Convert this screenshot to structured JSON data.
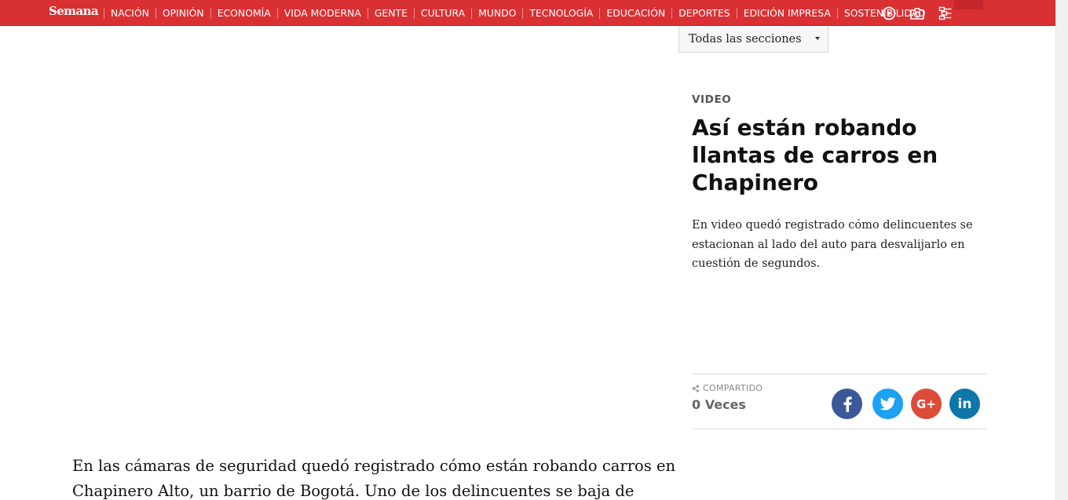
{
  "header": {
    "logo": "Semana",
    "nav_items": [
      "NACIÓN",
      "OPINIÓN",
      "ECONOMÍA",
      "VIDA MODERNA",
      "GENTE",
      "CULTURA",
      "MUNDO",
      "TECNOLOGÍA",
      "EDUCACIÓN",
      "DEPORTES",
      "EDICIÓN IMPRESA",
      "SOSTENIBILIDAD"
    ],
    "icons": [
      "play-icon",
      "camera-icon",
      "sections-menu-icon"
    ],
    "bar_color": "#d93034"
  },
  "section_select": {
    "value": "Todas las secciones"
  },
  "article": {
    "category": "VIDEO",
    "title": "Así están robando llantas de carros en Chapinero",
    "lead": "En video quedó registrado cómo delincuentes se estacionan al lado del auto para desvalijarlo en cuestión de segundos.",
    "body": "En las cámaras de seguridad quedó registrado cómo están robando carros en Chapinero Alto, un barrio de Bogotá. Uno de los delincuentes se baja de"
  },
  "share": {
    "label": "COMPARTIDO",
    "count": "0 Veces",
    "networks": [
      {
        "name": "facebook",
        "glyph": "f",
        "color": "#3b5998"
      },
      {
        "name": "twitter",
        "glyph": "t",
        "color": "#1da1f2"
      },
      {
        "name": "google-plus",
        "glyph": "G+",
        "color": "#dd4b39"
      },
      {
        "name": "linkedin",
        "glyph": "in",
        "color": "#0e76a8"
      }
    ]
  }
}
